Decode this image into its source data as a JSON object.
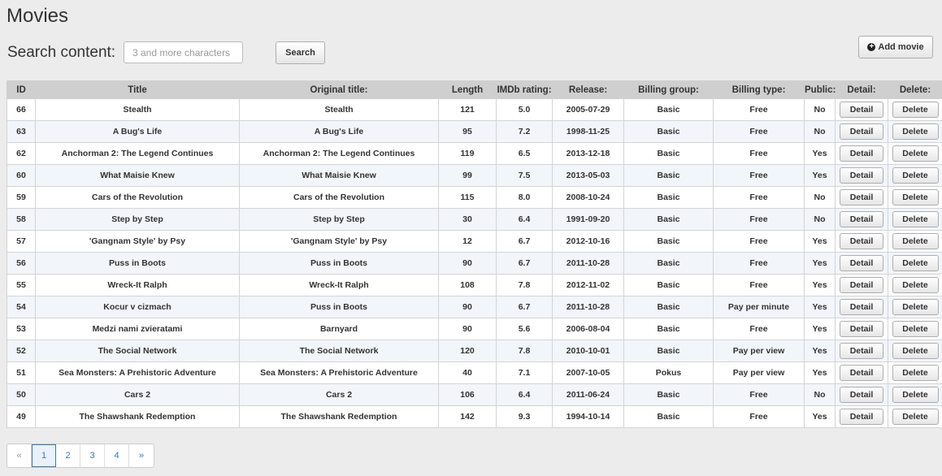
{
  "page": {
    "title": "Movies"
  },
  "search": {
    "label": "Search content:",
    "placeholder": "3 and more characters",
    "button_label": "Search"
  },
  "toolbar": {
    "add_label": "Add movie",
    "add_icon": "plus-circle-icon"
  },
  "table": {
    "headers": [
      "ID",
      "Title",
      "Original title:",
      "Length",
      "IMDb rating:",
      "Release:",
      "Billing group:",
      "Billing type:",
      "Public:",
      "Detail:",
      "Delete:"
    ],
    "detail_label": "Detail",
    "delete_label": "Delete",
    "rows": [
      {
        "id": "66",
        "title": "Stealth",
        "original": "Stealth",
        "length": "121",
        "rating": "5.0",
        "release": "2005-07-29",
        "group": "Basic",
        "type": "Free",
        "public": "No"
      },
      {
        "id": "63",
        "title": "A Bug's Life",
        "original": "A Bug's Life",
        "length": "95",
        "rating": "7.2",
        "release": "1998-11-25",
        "group": "Basic",
        "type": "Free",
        "public": "No"
      },
      {
        "id": "62",
        "title": "Anchorman 2: The Legend Continues",
        "original": "Anchorman 2: The Legend Continues",
        "length": "119",
        "rating": "6.5",
        "release": "2013-12-18",
        "group": "Basic",
        "type": "Free",
        "public": "Yes"
      },
      {
        "id": "60",
        "title": "What Maisie Knew",
        "original": "What Maisie Knew",
        "length": "99",
        "rating": "7.5",
        "release": "2013-05-03",
        "group": "Basic",
        "type": "Free",
        "public": "Yes"
      },
      {
        "id": "59",
        "title": "Cars of the Revolution",
        "original": "Cars of the Revolution",
        "length": "115",
        "rating": "8.0",
        "release": "2008-10-24",
        "group": "Basic",
        "type": "Free",
        "public": "No"
      },
      {
        "id": "58",
        "title": "Step by Step",
        "original": "Step by Step",
        "length": "30",
        "rating": "6.4",
        "release": "1991-09-20",
        "group": "Basic",
        "type": "Free",
        "public": "No"
      },
      {
        "id": "57",
        "title": "'Gangnam Style' by Psy",
        "original": "'Gangnam Style' by Psy",
        "length": "12",
        "rating": "6.7",
        "release": "2012-10-16",
        "group": "Basic",
        "type": "Free",
        "public": "Yes"
      },
      {
        "id": "56",
        "title": "Puss in Boots",
        "original": "Puss in Boots",
        "length": "90",
        "rating": "6.7",
        "release": "2011-10-28",
        "group": "Basic",
        "type": "Free",
        "public": "Yes"
      },
      {
        "id": "55",
        "title": "Wreck-It Ralph",
        "original": "Wreck-It Ralph",
        "length": "108",
        "rating": "7.8",
        "release": "2012-11-02",
        "group": "Basic",
        "type": "Free",
        "public": "Yes"
      },
      {
        "id": "54",
        "title": "Kocur v cizmach",
        "original": "Puss in Boots",
        "length": "90",
        "rating": "6.7",
        "release": "2011-10-28",
        "group": "Basic",
        "type": "Pay per minute",
        "public": "Yes"
      },
      {
        "id": "53",
        "title": "Medzi nami zvieratami",
        "original": "Barnyard",
        "length": "90",
        "rating": "5.6",
        "release": "2006-08-04",
        "group": "Basic",
        "type": "Free",
        "public": "Yes"
      },
      {
        "id": "52",
        "title": "The Social Network",
        "original": "The Social Network",
        "length": "120",
        "rating": "7.8",
        "release": "2010-10-01",
        "group": "Basic",
        "type": "Pay per view",
        "public": "Yes"
      },
      {
        "id": "51",
        "title": "Sea Monsters: A Prehistoric Adventure",
        "original": "Sea Monsters: A Prehistoric Adventure",
        "length": "40",
        "rating": "7.1",
        "release": "2007-10-05",
        "group": "Pokus",
        "type": "Pay per view",
        "public": "Yes"
      },
      {
        "id": "50",
        "title": "Cars 2",
        "original": "Cars 2",
        "length": "106",
        "rating": "6.4",
        "release": "2011-06-24",
        "group": "Basic",
        "type": "Free",
        "public": "No"
      },
      {
        "id": "49",
        "title": "The Shawshank Redemption",
        "original": "The Shawshank Redemption",
        "length": "142",
        "rating": "9.3",
        "release": "1994-10-14",
        "group": "Basic",
        "type": "Free",
        "public": "Yes"
      }
    ]
  },
  "pagination": {
    "items": [
      {
        "label": "«",
        "state": "muted"
      },
      {
        "label": "1",
        "state": "active"
      },
      {
        "label": "2",
        "state": ""
      },
      {
        "label": "3",
        "state": ""
      },
      {
        "label": "4",
        "state": ""
      },
      {
        "label": "»",
        "state": ""
      }
    ]
  }
}
